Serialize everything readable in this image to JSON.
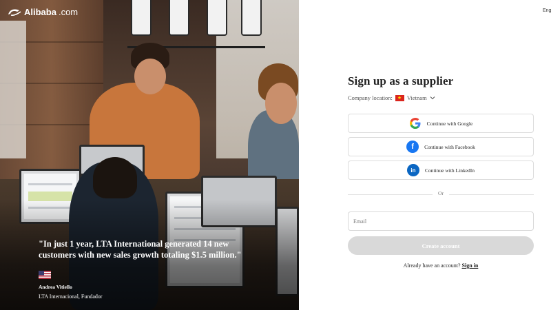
{
  "hero": {
    "logo_text": "Alibaba",
    "logo_suffix": ".com",
    "quote": "\"In just 1 year, LTA International generated 14 new customers with new sales growth totaling $1.5 million.\"",
    "author_name": "Andrea Vitiello",
    "author_title": "LTA Internacional, Fundador",
    "author_flag_icon": "us-flag-icon"
  },
  "header": {
    "language": "Eng"
  },
  "form": {
    "title": "Sign up as a supplier",
    "location_label": "Company location:",
    "location_value": "Vietnam",
    "location_flag_icon": "vietnam-flag-icon",
    "social_buttons": [
      {
        "label": "Continue with Google",
        "icon": "google-icon"
      },
      {
        "label": "Continue with Facebook",
        "icon": "facebook-icon"
      },
      {
        "label": "Continue with LinkedIn",
        "icon": "linkedin-icon"
      }
    ],
    "divider_text": "Or",
    "email_placeholder": "Email",
    "email_value": "",
    "create_button_label": "Create account",
    "signin_prompt": "Already have an account?",
    "signin_link": "Sign in"
  },
  "colors": {
    "brand_orange": "#ff6a00",
    "facebook_blue": "#1877f2",
    "linkedin_blue": "#0a66c2",
    "button_disabled": "#d9d9d9"
  }
}
